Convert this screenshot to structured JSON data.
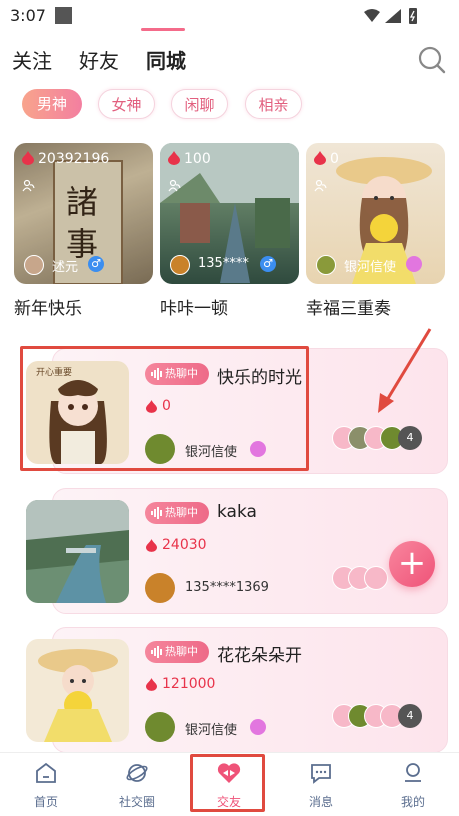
{
  "status_bar": {
    "time": "3:07"
  },
  "top_tabs": [
    "关注",
    "好友",
    "同城"
  ],
  "active_top_tab": "同城",
  "categories": [
    "男神",
    "女神",
    "闲聊",
    "相亲"
  ],
  "featured": [
    {
      "count": "20392196",
      "user": "述元",
      "title": "新年快乐",
      "gender": "♂"
    },
    {
      "count": "100",
      "user": "135****",
      "title": "咔咔一顿",
      "gender": "♂"
    },
    {
      "count": "0",
      "user": "银河信使",
      "title": "幸福三重奏",
      "gender": ""
    }
  ],
  "rooms": [
    {
      "badge": "热聊中",
      "title": "快乐的时光",
      "count": "0",
      "host": "银河信使",
      "members": "4",
      "image_caption": "开心重要"
    },
    {
      "badge": "热聊中",
      "title": "kaka",
      "count": "24030",
      "host": "135****1369",
      "members": ""
    },
    {
      "badge": "热聊中",
      "title": "花花朵朵开",
      "count": "121000",
      "host": "银河信使",
      "members": "4"
    }
  ],
  "fab_label": "+",
  "bottom_nav": [
    "首页",
    "社交圈",
    "交友",
    "消息",
    "我的"
  ],
  "active_nav": "交友",
  "colors": {
    "accent": "#ef5378",
    "highlight_box": "#e04a3f"
  }
}
